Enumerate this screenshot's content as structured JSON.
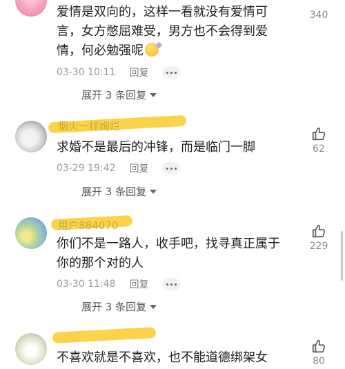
{
  "comments": [
    {
      "username": "",
      "text_lines": [
        "爱情是双向的，这样一看就没有爱情可",
        "言，女方憋屈难受，男方也不会得到爱",
        "情，何必勉强呢"
      ],
      "date": "03-30 10:11",
      "reply": "回复",
      "expand": "展开 3 条回复",
      "likes": "340",
      "avatar": "avatar-pink"
    },
    {
      "username": "烟火一样绚烂",
      "text_lines": [
        "求婚不是最后的冲锋，而是临门一脚"
      ],
      "date": "03-29 19:42",
      "reply": "回复",
      "expand": "展开 3 条回复",
      "likes": "62",
      "avatar": "avatar-white-cat"
    },
    {
      "username": "用户884070",
      "text_lines": [
        "你们不是一路人，收手吧，找寻真正属于",
        "你的那个对的人"
      ],
      "date": "03-30 11:48",
      "reply": "回复",
      "expand": "展开 3 条回复",
      "likes": "229",
      "avatar": "avatar-flowers"
    },
    {
      "username": "",
      "text_lines": [
        "不喜欢就是不喜欢，也不能道德绑架女"
      ],
      "likes": "80",
      "avatar": "avatar-dog"
    }
  ],
  "icons": {
    "like": "thumbs-up-icon",
    "more": "more-dots-icon",
    "expand_caret": "caret-down-icon"
  },
  "colors": {
    "highlight": "#facd32",
    "meta": "#9a9a9a"
  }
}
